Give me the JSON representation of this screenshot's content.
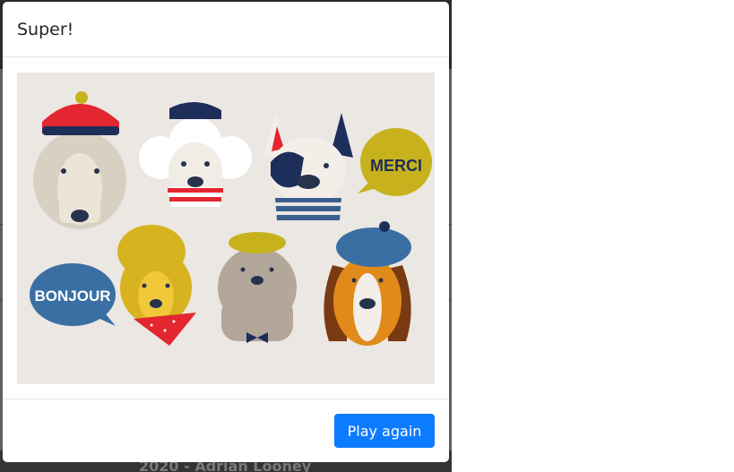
{
  "modal": {
    "title": "Super!",
    "play_again_label": "Play again",
    "illustration": {
      "speech_bubble_right": "MERCI",
      "speech_bubble_left": "BONJOUR"
    }
  },
  "background": {
    "footer_text": "2020 - Adrian Looney"
  },
  "colors": {
    "primary_button": "#0d7bff",
    "illustration_bg": "#ebe7e2",
    "overlay_bg": "#5f5f5f"
  }
}
